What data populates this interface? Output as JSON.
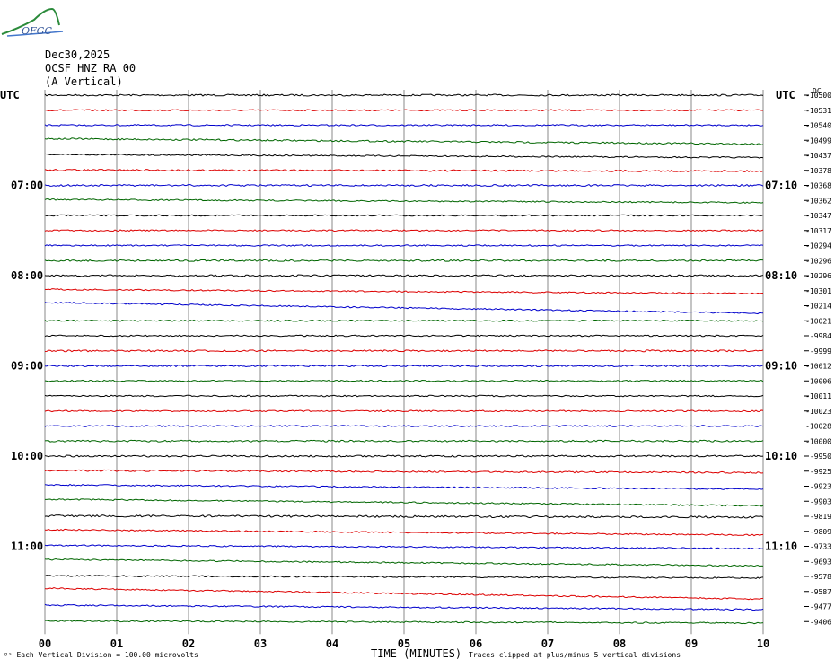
{
  "logo": {
    "text": "OFGC"
  },
  "header": {
    "date": "Dec30,2025",
    "station": "OCSF HNZ RA 00",
    "component": "(A Vertical)"
  },
  "axis": {
    "left_utc": "UTC",
    "right_utc": "UTC",
    "xlabel": "TIME (MINUTES)",
    "scale_note": "Each Vertical Division =  100.00 microvolts",
    "clip_note": "Traces clipped at plus/minus 5 vertical divisions",
    "dc_label": "DC"
  },
  "colors": {
    "trace_cycle": [
      "#000000",
      "#dd0000",
      "#0000cc",
      "#006600"
    ],
    "grid": "#888888"
  },
  "chart_data": {
    "type": "line",
    "title": "",
    "xlabel": "TIME (MINUTES)",
    "ylabel": "",
    "xlim": [
      0,
      10
    ],
    "x_ticks": [
      "00",
      "01",
      "02",
      "03",
      "04",
      "05",
      "06",
      "07",
      "08",
      "09",
      "10"
    ],
    "grid": true,
    "rows_per_hour": 6,
    "left_hour_labels": [
      {
        "row": 6,
        "label": "07:00"
      },
      {
        "row": 12,
        "label": "08:00"
      },
      {
        "row": 18,
        "label": "09:00"
      },
      {
        "row": 24,
        "label": "10:00"
      },
      {
        "row": 30,
        "label": "11:00"
      }
    ],
    "right_hour_labels": [
      {
        "row": 6,
        "label": "07:10"
      },
      {
        "row": 12,
        "label": "08:10"
      },
      {
        "row": 18,
        "label": "09:10"
      },
      {
        "row": 24,
        "label": "10:10"
      },
      {
        "row": 30,
        "label": "11:10"
      }
    ],
    "dc_offsets": [
      "-10500",
      "-10531",
      "-10540",
      "-10499",
      "-10437",
      "-10378",
      "-10368",
      "-10362",
      "-10347",
      "-10317",
      "-10294",
      "-10296",
      "-10296",
      "-10301",
      "-10214",
      "-10021",
      "-9984",
      "-9999",
      "-10012",
      "-10006",
      "-10011",
      "-10023",
      "-10028",
      "-10000",
      "-9950",
      "-9925",
      "-9923",
      "-9903",
      "-9819",
      "-9809",
      "-9733",
      "-9693",
      "-9578",
      "-9587",
      "-9477",
      "-9406"
    ],
    "trace_drift": [
      0,
      0,
      0,
      0.5,
      0.3,
      0.1,
      0,
      0.3,
      0,
      0,
      0,
      0,
      0,
      0.4,
      1.0,
      0,
      0,
      0,
      0,
      0,
      0,
      0,
      0,
      0,
      0,
      0.2,
      0.4,
      0.6,
      0.1,
      0.5,
      0.3,
      0.6,
      0.2,
      1.0,
      0.4,
      0.2
    ],
    "trace_noise": [
      0.6,
      0.5,
      0.5,
      0.6,
      0.5,
      0.6,
      0.6,
      0.5,
      0.5,
      0.5,
      0.5,
      0.6,
      0.6,
      0.5,
      0.5,
      0.5,
      0.5,
      0.6,
      0.6,
      0.5,
      0.5,
      0.5,
      0.5,
      0.6,
      0.6,
      0.6,
      0.5,
      0.5,
      0.7,
      0.5,
      0.5,
      0.5,
      0.5,
      0.5,
      0.5,
      0.5
    ]
  }
}
